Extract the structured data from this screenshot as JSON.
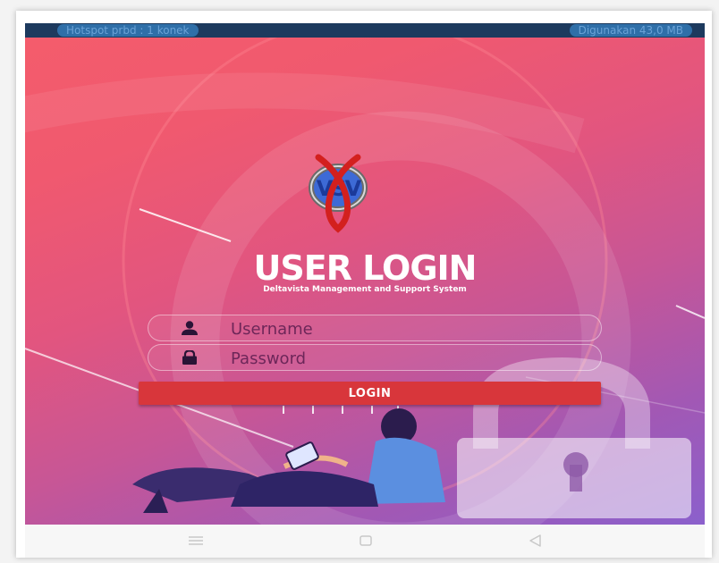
{
  "status_bar": {
    "hotspot_text": "Hotspot prbd : 1 konek",
    "usage_text": "Digunakan 43,0 MB"
  },
  "login": {
    "title": "USER LOGIN",
    "subtitle": "Deltavista Management and Support System",
    "username_placeholder": "Username",
    "password_placeholder": "Password",
    "button_label": "LOGIN"
  },
  "logo": {
    "monogram": "VSV"
  },
  "colors": {
    "login_button": "#d8363b",
    "gradient_top": "#f45c6c",
    "gradient_bottom": "#8b60cc",
    "logo_red": "#d3201e",
    "logo_blue": "#2f5fc0"
  },
  "navigation": {
    "icons": [
      "menu-icon",
      "home-icon",
      "back-icon"
    ]
  }
}
